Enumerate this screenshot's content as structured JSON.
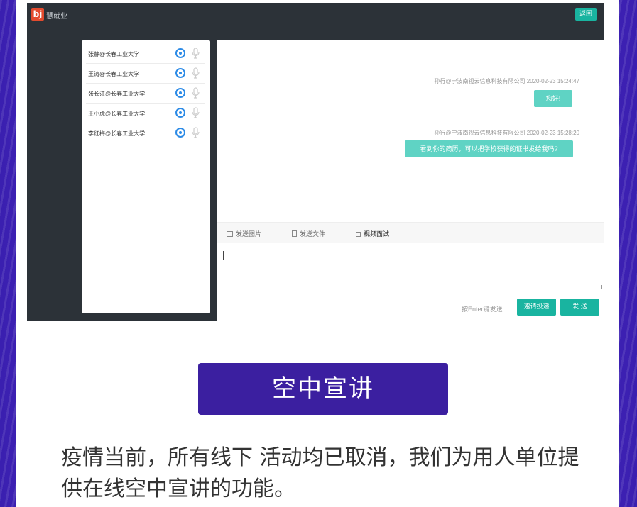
{
  "app": {
    "logo": "bj",
    "title": "慧就业",
    "back_label": "返回"
  },
  "contacts": [
    {
      "name": "张静@长春工业大学"
    },
    {
      "name": "王涛@长春工业大学"
    },
    {
      "name": "张长江@长春工业大学"
    },
    {
      "name": "王小虎@长春工业大学"
    },
    {
      "name": "李红梅@长春工业大学"
    }
  ],
  "messages": [
    {
      "meta": "孙行@宁波南视云信息科技有限公司  2020-02-23 15:24:47",
      "text": "您好!"
    },
    {
      "meta": "孙行@宁波南视云信息科技有限公司  2020-02-23 15:28:20",
      "text": "看到你的简历，可以把学校获得的证书发给我吗?"
    }
  ],
  "toolbar": {
    "send_image": "发送图片",
    "send_file": "发送文件",
    "video_interview": "视频面试"
  },
  "composer": {
    "hint": "按Enter键发送",
    "invite_label": "邀请投递",
    "send_label": "发 送"
  },
  "banner": {
    "title": "空中宣讲"
  },
  "description": "疫情当前，所有线下 活动均已取消，我们为用人单位提供在线空中宣讲的功能。",
  "colors": {
    "accent": "#19b4a0",
    "bubble": "#5fd3c4",
    "banner": "#3b1fa0",
    "icon_blue": "#2b8ae6"
  }
}
